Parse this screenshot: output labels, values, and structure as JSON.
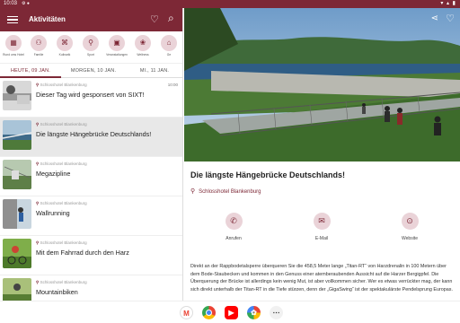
{
  "status": {
    "time": "10:03",
    "extra": "⚙ ●",
    "icons": "▾ ▴ ▮"
  },
  "appbar": {
    "title": "Aktivitäten",
    "menu_icon": "menu-icon",
    "heart_icon": "heart-outline-icon",
    "search_icon": "search-icon"
  },
  "categories": [
    {
      "label": "Rund ums Hotel",
      "icon": "map-icon",
      "glyph": "▦"
    },
    {
      "label": "Familie",
      "icon": "family-icon",
      "glyph": "⚇"
    },
    {
      "label": "Kulinarik",
      "icon": "cutlery-icon",
      "glyph": "⌘"
    },
    {
      "label": "Sport",
      "icon": "bike-icon",
      "glyph": "⚲"
    },
    {
      "label": "Veranstaltungen",
      "icon": "ticket-icon",
      "glyph": "▣"
    },
    {
      "label": "Wellness",
      "icon": "lotus-icon",
      "glyph": "❀"
    },
    {
      "label": "Ge",
      "icon": "more-icon",
      "glyph": "⌂"
    }
  ],
  "tabs": [
    {
      "label": "HEUTE, 09 JAN."
    },
    {
      "label": "MORGEN, 10 JAN."
    },
    {
      "label": "MI., 11 JAN."
    }
  ],
  "items": [
    {
      "location": "Schlosshotel Blankenburg",
      "name": "Dieser Tag wird gesponsert von SIXT!",
      "time": "10:00"
    },
    {
      "location": "Schlosshotel Blankenburg",
      "name": "Die längste Hängebrücke Deutschlands!",
      "time": ""
    },
    {
      "location": "Schlosshotel Blankenburg",
      "name": "Megazipline",
      "time": ""
    },
    {
      "location": "Schlosshotel Blankenburg",
      "name": "Wallrunning",
      "time": ""
    },
    {
      "location": "Schlosshotel Blankenburg",
      "name": "Mit dem Fahrrad durch den Harz",
      "time": ""
    },
    {
      "location": "Schlosshotel Blankenburg",
      "name": "Mountainbiken",
      "time": ""
    }
  ],
  "detail": {
    "title": "Die längste Hängebrücke Deutschlands!",
    "location": "Schlosshotel Blankenburg",
    "actions": [
      {
        "label": "Anrufen",
        "icon": "phone-icon",
        "glyph": "✆"
      },
      {
        "label": "E-Mail",
        "icon": "mail-icon",
        "glyph": "✉"
      },
      {
        "label": "Website",
        "icon": "link-icon",
        "glyph": "⊙"
      }
    ],
    "description": "Direkt an der Rappbodetalsperre überqueren Sie die 458,5 Meter lange „Titan-RT“ von Harzdrenalin in 100 Metern über dem Bode-Staubecken und kommen in den Genuss einer atemberaubenden Aussicht auf die Harzer Bergigpfel. Die Überquerung der Brücke ist allerdings kein wenig Mut, ist aber vollkommen sicher. Wer es etwas verrückter mag, der kann sich direkt unterhalb der Titan-RT in die Tiefe stürzen, denn der „GigaSwing“ ist der spektakulärste Pendelsprung Europas.",
    "share_icon": "share-icon",
    "fav_icon": "heart-outline-icon"
  },
  "dock": [
    {
      "name": "gmail-app-icon",
      "glyph": "M",
      "color": "#ea4335"
    },
    {
      "name": "chrome-app-icon",
      "glyph": "",
      "color": "#34a853"
    },
    {
      "name": "youtube-app-icon",
      "glyph": "▶",
      "color": "#ff0000"
    },
    {
      "name": "photos-app-icon",
      "glyph": "✿",
      "color": "#fbbc05"
    },
    {
      "name": "apps-grid-icon",
      "glyph": "⋯",
      "color": "#333333"
    }
  ],
  "colors": {
    "brand": "#7d2836",
    "accent_soft": "#ead3d8"
  }
}
